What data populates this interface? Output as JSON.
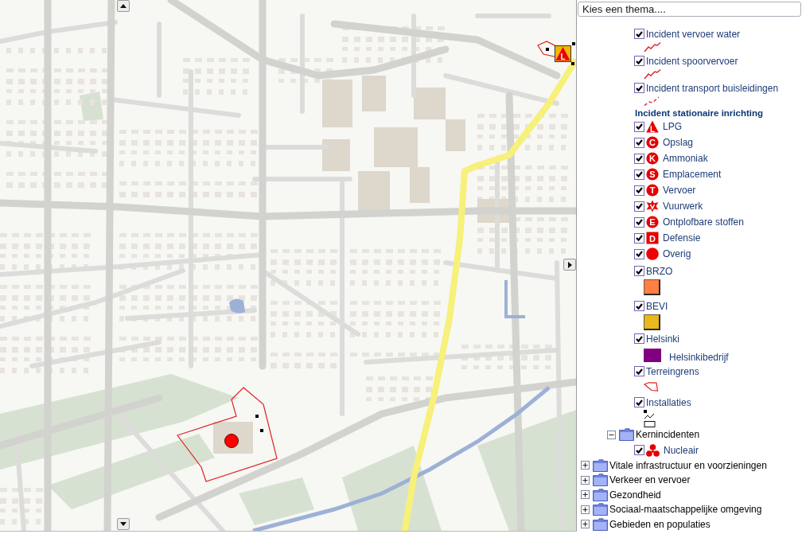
{
  "map": {
    "incident_marker": {
      "letter": "L"
    }
  },
  "theme_select": {
    "value": "Kies een thema...."
  },
  "legend": {
    "tree": [
      {
        "children": [
          {
            "children": [
              {
                "kind": "line",
                "label": "Incident vervoer water",
                "checked": true
              },
              {
                "kind": "line",
                "label": "Incident spoorvervoer",
                "checked": true
              },
              {
                "kind": "dashed-line",
                "label": "Incident transport buisleidingen",
                "checked": true
              },
              {
                "kind": "heading",
                "label": "Incident stationaire inrichting"
              },
              {
                "kind": "triangle",
                "label": "LPG",
                "checked": true,
                "letter": "L"
              },
              {
                "kind": "circle",
                "label": "Opslag",
                "checked": true,
                "letter": "C"
              },
              {
                "kind": "circle",
                "label": "Ammoniak",
                "checked": true,
                "letter": "K"
              },
              {
                "kind": "circle",
                "label": "Emplacement",
                "checked": true,
                "letter": "S"
              },
              {
                "kind": "circle",
                "label": "Vervoer",
                "checked": true,
                "letter": "T"
              },
              {
                "kind": "burst",
                "label": "Vuurwerk",
                "checked": true
              },
              {
                "kind": "circle",
                "label": "Ontplofbare stoffen",
                "checked": true,
                "letter": "E"
              },
              {
                "kind": "square",
                "label": "Defensie",
                "checked": true,
                "letter": "D"
              },
              {
                "kind": "dot",
                "label": "Overig",
                "checked": true
              },
              {
                "kind": "swatch",
                "label": "BRZO",
                "checked": true,
                "color": "#ff8040"
              },
              {
                "kind": "swatch",
                "label": "BEVI",
                "checked": true,
                "color": "#e8b81c"
              },
              {
                "kind": "fill",
                "label": "Helsinki",
                "checked": true,
                "color": "#800080",
                "caption": "Helsinkibedrijf"
              },
              {
                "kind": "outline",
                "label": "Terreingrens",
                "checked": true
              },
              {
                "kind": "installation",
                "label": "Installaties",
                "checked": true
              }
            ]
          },
          {
            "label": "Kernincidenten",
            "expanded": true,
            "children": [
              {
                "kind": "trefoil",
                "label": "Nucleair",
                "checked": true
              }
            ]
          }
        ]
      },
      {
        "label": "Vitale infrastructuur en voorzieningen",
        "expanded": false
      },
      {
        "label": "Verkeer en vervoer",
        "expanded": false
      },
      {
        "label": "Gezondheid",
        "expanded": false
      },
      {
        "label": "Sociaal-maatschappelijke omgeving",
        "expanded": false
      },
      {
        "label": "Gebieden en populaties",
        "expanded": false
      }
    ]
  }
}
